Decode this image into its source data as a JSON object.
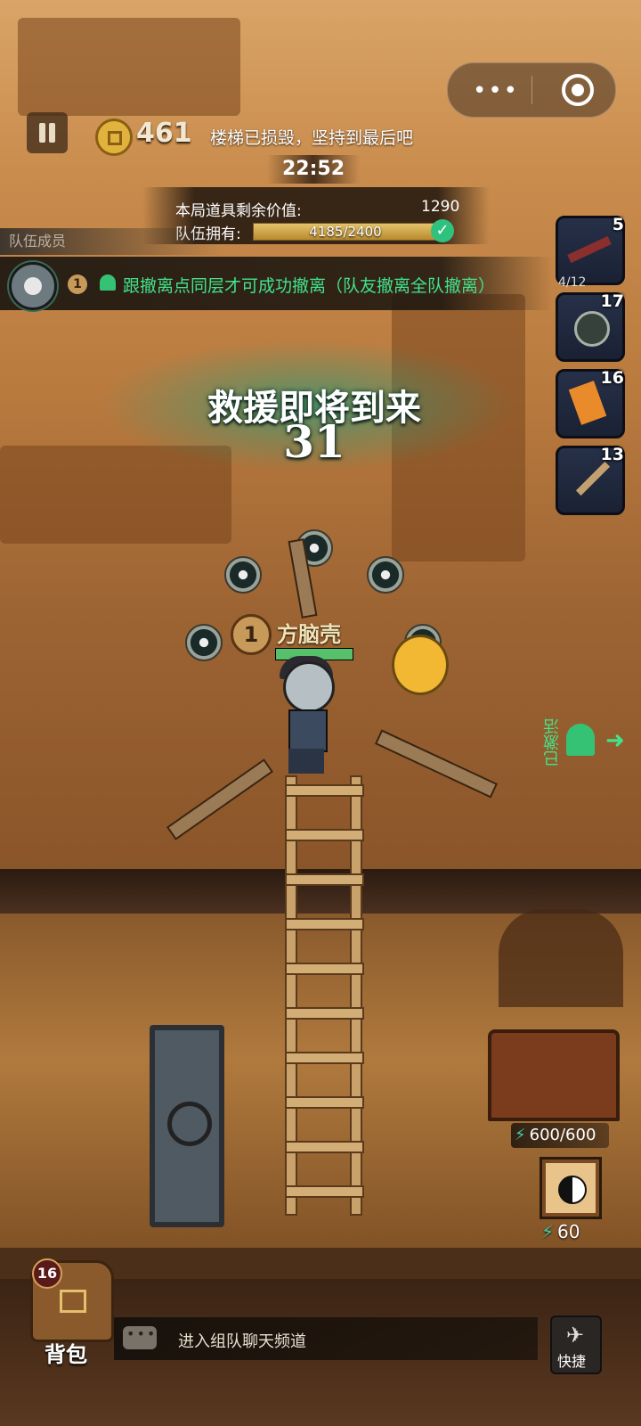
{
  "header": {
    "coins": "461",
    "notice": "楼梯已损毁，坚持到最后吧",
    "timer": "22:52"
  },
  "value_panel": {
    "remaining_label": "本局道具剩余价值:",
    "remaining_value": "1290",
    "team_label": "队伍拥有:",
    "team_progress_text": "4185/2400",
    "team_progress_fraction": 1.0
  },
  "team": {
    "header": "队伍成员",
    "member_rank": "1",
    "evac_tip": "跟撤离点同层才可成功撤离（队友撤离全队撤离）"
  },
  "side_items": [
    {
      "icon": "rifle-icon",
      "count": "5",
      "sub": "4/12"
    },
    {
      "icon": "amulet-icon",
      "count": "17"
    },
    {
      "icon": "scroll-icon",
      "count": "16"
    },
    {
      "icon": "dagger-icon",
      "count": "13"
    }
  ],
  "rescue": {
    "title": "救援即将到来",
    "countdown": "31"
  },
  "player": {
    "rank": "1",
    "name": "方脑壳",
    "hp_fraction": 1.0
  },
  "checkpoint": {
    "label": "已激活"
  },
  "skill": {
    "energy": "600/600",
    "cost": "60"
  },
  "backpack": {
    "count": "16",
    "label": "背包"
  },
  "chat": {
    "placeholder": "进入组队聊天频道"
  },
  "quick": {
    "label": "快捷"
  },
  "colors": {
    "evac_green": "#42e38b",
    "rescue_teal": "#1ea082",
    "gold": "#e1b33e"
  }
}
